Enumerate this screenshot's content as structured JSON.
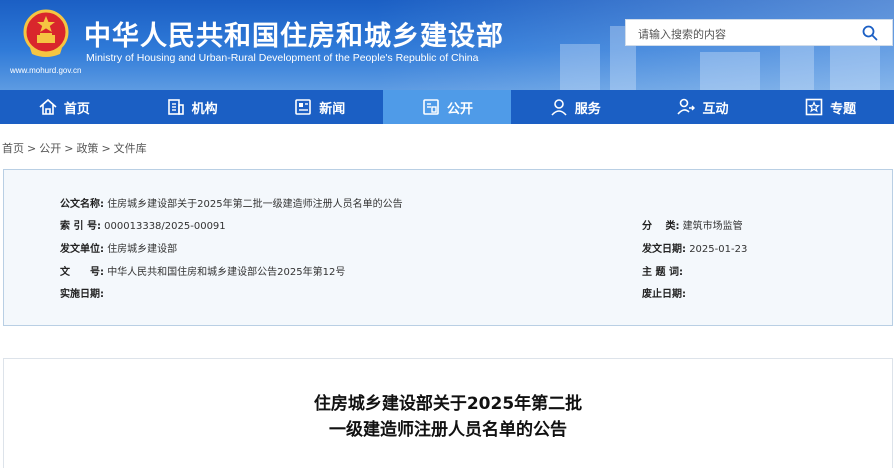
{
  "header": {
    "title_cn": "中华人民共和国住房和城乡建设部",
    "title_en": "Ministry of Housing and Urban-Rural Development of the People's Republic of China",
    "url": "www.mohurd.gov.cn",
    "search_placeholder": "请输入搜索的内容"
  },
  "nav": [
    {
      "label": "首页",
      "icon": "home-icon"
    },
    {
      "label": "机构",
      "icon": "building-icon"
    },
    {
      "label": "新闻",
      "icon": "news-icon"
    },
    {
      "label": "公开",
      "icon": "document-icon",
      "active": true
    },
    {
      "label": "服务",
      "icon": "service-icon"
    },
    {
      "label": "互动",
      "icon": "interaction-icon"
    },
    {
      "label": "专题",
      "icon": "star-icon"
    }
  ],
  "breadcrumb": [
    "首页",
    "公开",
    "政策",
    "文件库"
  ],
  "meta": {
    "doc_name_label": "公文名称:",
    "doc_name": "住房城乡建设部关于2025年第二批一级建造师注册人员名单的公告",
    "index_label": "索 引 号:",
    "index": "000013338/2025-00091",
    "category_label": "分　 类:",
    "category": "建筑市场监管",
    "issuer_label": "发文单位:",
    "issuer": "住房城乡建设部",
    "date_label": "发文日期:",
    "date": "2025-01-23",
    "number_label": "文　　号:",
    "number": "中华人民共和国住房和城乡建设部公告2025年第12号",
    "subject_label": "主 题 词:",
    "subject": "",
    "effective_label": "实施日期:",
    "effective": "",
    "abolish_label": "废止日期:",
    "abolish": ""
  },
  "article": {
    "title_line1": "住房城乡建设部关于2025年第二批",
    "title_line2": "一级建造师注册人员名单的公告"
  },
  "colors": {
    "header_blue": "#1b5fc4",
    "nav_active": "#4f9be8",
    "meta_bg": "#f4f8fc",
    "meta_border": "#b9cfe4"
  }
}
